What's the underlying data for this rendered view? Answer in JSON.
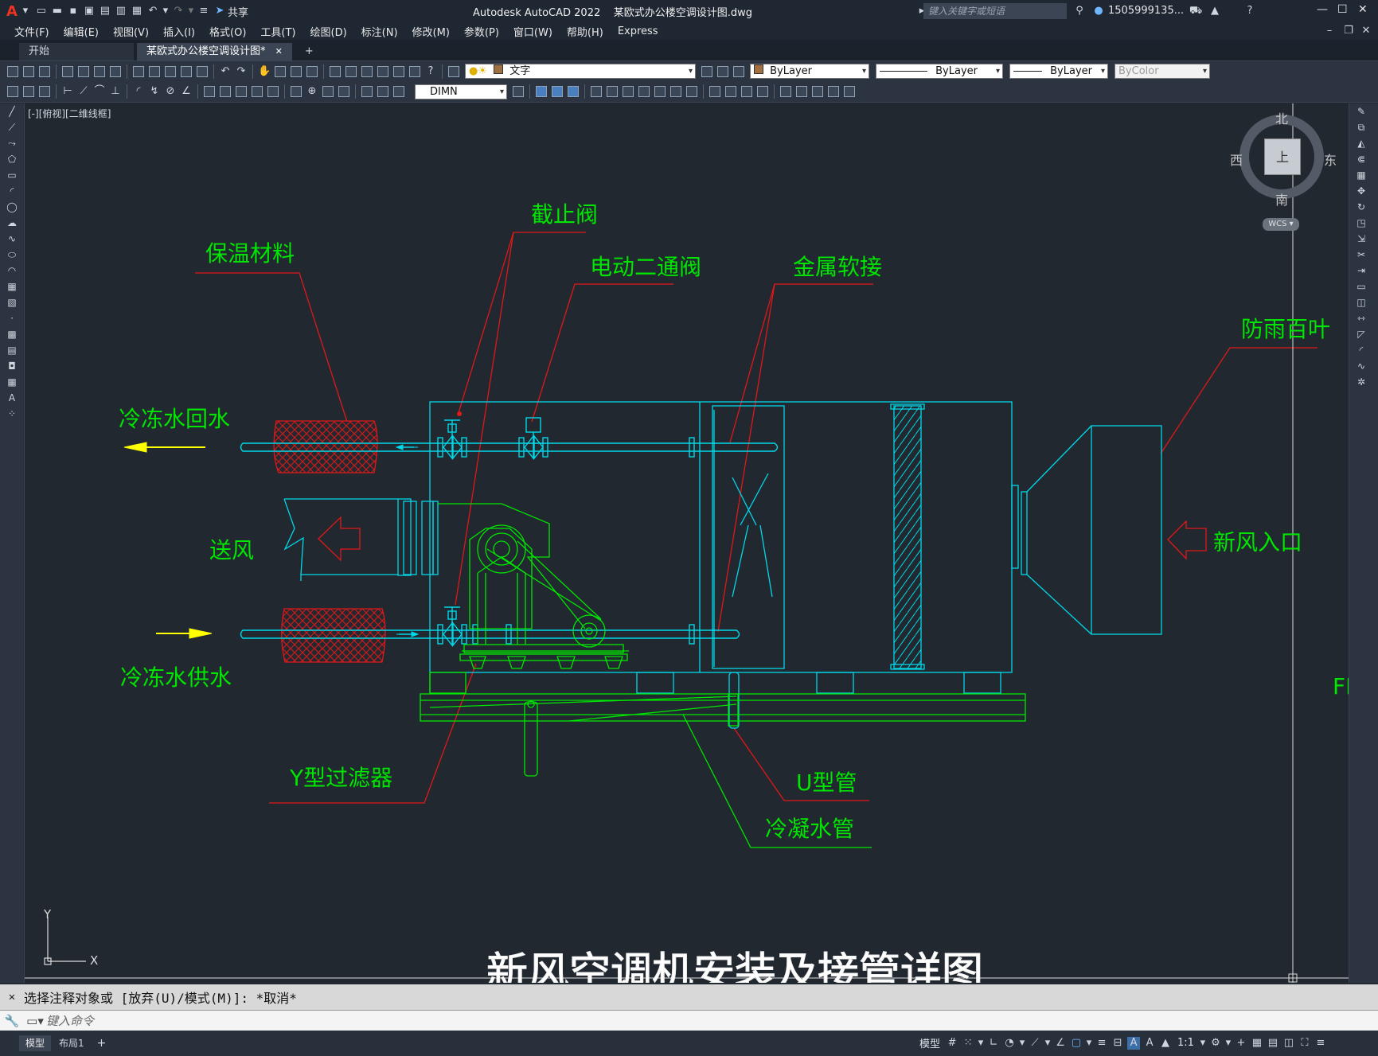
{
  "app": {
    "title": "Autodesk AutoCAD 2022    某欧式办公楼空调设计图.dwg",
    "share_label": "共享",
    "search_placeholder": "键入关键字或短语",
    "user": "1505999135...",
    "window_buttons": [
      "—",
      "☐",
      "✕"
    ]
  },
  "menu": [
    "文件(F)",
    "编辑(E)",
    "视图(V)",
    "插入(I)",
    "格式(O)",
    "工具(T)",
    "绘图(D)",
    "标注(N)",
    "修改(M)",
    "参数(P)",
    "窗口(W)",
    "帮助(H)",
    "Express"
  ],
  "tabs": {
    "start": "开始",
    "active": "某欧式办公楼空调设计图*",
    "close": "✕",
    "new": "+"
  },
  "toolbar": {
    "layer": "文字",
    "color": "ByLayer",
    "linetype": "ByLayer",
    "lineweight": "ByLayer",
    "plotstyle": "ByColor",
    "dimstyle": "DIMN"
  },
  "viewport": {
    "label": "[-][俯视][二维线框]",
    "viewcube": {
      "north": "北",
      "south": "南",
      "east": "东",
      "west": "西",
      "top": "上",
      "wcs": "WCS"
    },
    "ucs": {
      "x": "X",
      "y": "Y"
    }
  },
  "drawing": {
    "colors": {
      "green": "#00e600",
      "cyan": "#00d8e8",
      "red": "#e01818",
      "yellow": "#ffff00"
    },
    "labels": {
      "insulation": "保温材料",
      "stop_valve": "截止阀",
      "electric_valve": "电动二通阀",
      "flex_joint": "金属软接",
      "rain_louver": "防雨百叶",
      "return_water": "冷冻水回水",
      "supply_air": "送风",
      "supply_water": "冷冻水供水",
      "fresh_air": "新风入口",
      "y_filter": "Y型过滤器",
      "u_pipe": "U型管",
      "condensate": "冷凝水管",
      "edge_fragment": "FF",
      "title": "新风空调机安装及接管详图"
    }
  },
  "command": {
    "history": "选择注释对象或 [放弃(U)/模式(M)]: *取消*",
    "placeholder": "键入命令"
  },
  "status": {
    "model_tab": "模型",
    "layout_tab": "布局1",
    "add": "+",
    "model_button": "模型",
    "scale": "1:1"
  }
}
